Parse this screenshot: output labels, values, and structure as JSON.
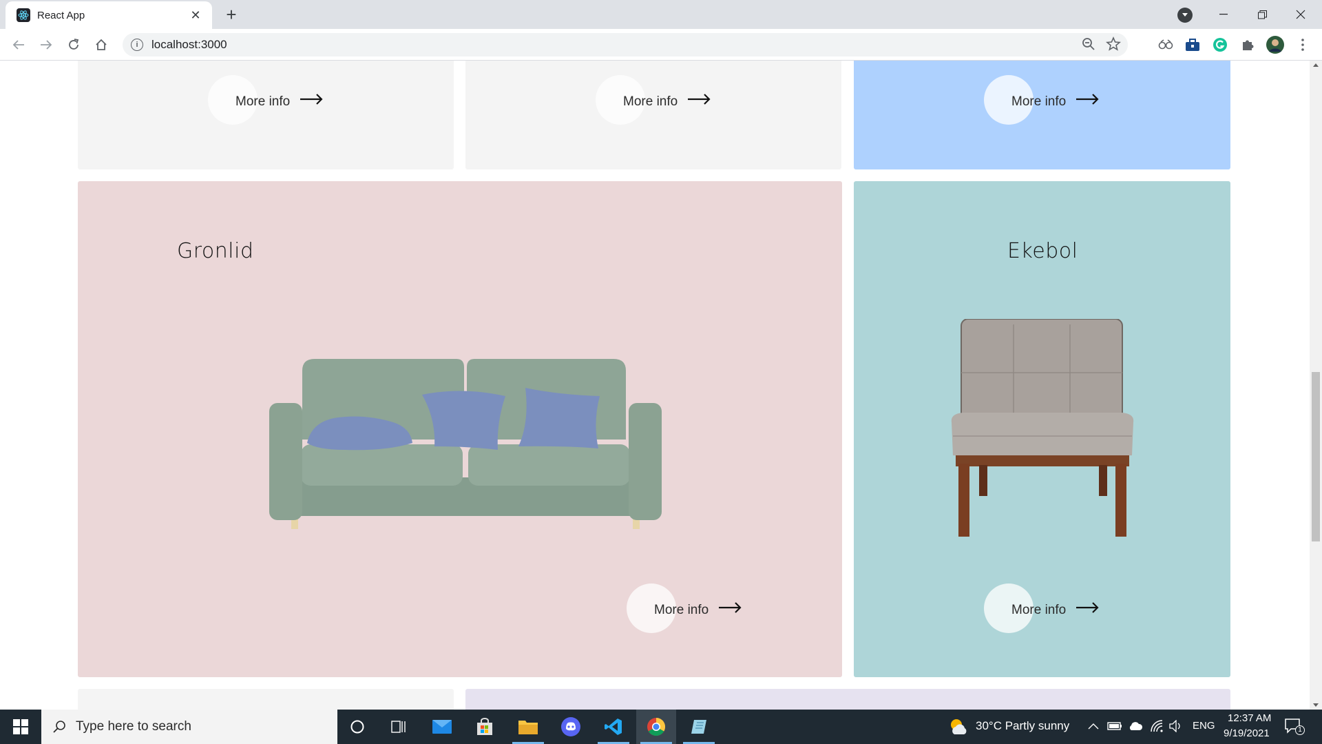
{
  "browser": {
    "tab_title": "React App",
    "url": "localhost:3000"
  },
  "page": {
    "top_cards": [
      {
        "more_info": "More info",
        "bg": "#f4f4f4"
      },
      {
        "more_info": "More info",
        "bg": "#f4f4f4"
      },
      {
        "more_info": "More info",
        "bg": "#aed1fe"
      }
    ],
    "products": [
      {
        "title": "Gronlid",
        "more_info": "More info",
        "bg": "#ebd7d8",
        "image": "green-sofa-with-blue-cushions"
      },
      {
        "title": "Ekebol",
        "more_info": "More info",
        "bg": "#aed5d8",
        "image": "grey-armchair-wooden-legs"
      }
    ],
    "bottom_cards": [
      {
        "bg": "#f4f4f4"
      },
      {
        "bg": "#e6e2f0"
      }
    ]
  },
  "taskbar": {
    "search_placeholder": "Type here to search",
    "weather": "30°C  Partly sunny",
    "language": "ENG",
    "time": "12:37 AM",
    "date": "9/19/2021",
    "notifications": "1"
  }
}
